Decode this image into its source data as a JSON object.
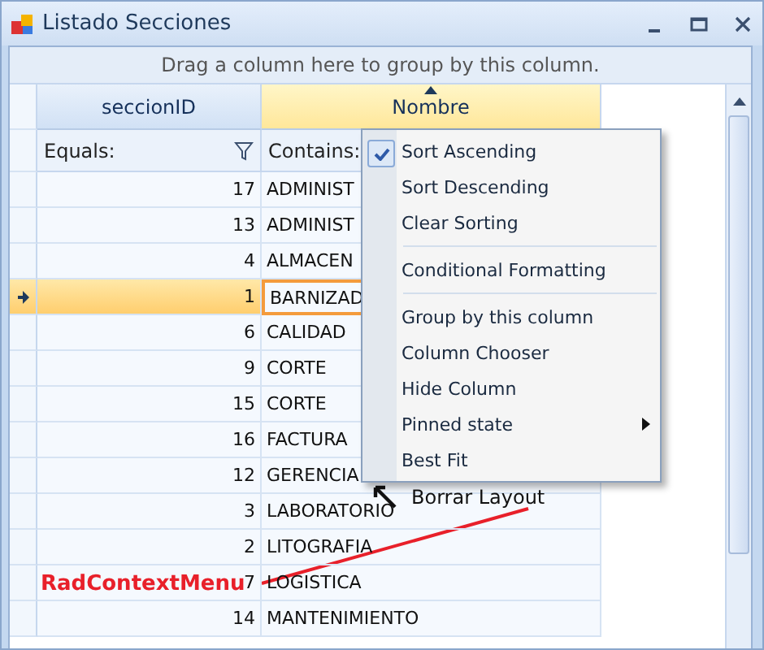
{
  "window": {
    "title": "Listado Secciones"
  },
  "group_panel": {
    "hint": "Drag a column here to group by this column."
  },
  "columns": [
    {
      "label": "seccionID",
      "sorted": false
    },
    {
      "label": "Nombre",
      "sorted": true
    }
  ],
  "filters": [
    {
      "label": "Equals:"
    },
    {
      "label": "Contains:"
    }
  ],
  "rows": [
    {
      "id": "17",
      "name": "ADMINIST",
      "selected": false
    },
    {
      "id": "13",
      "name": "ADMINIST",
      "selected": false
    },
    {
      "id": "4",
      "name": "ALMACEN",
      "selected": false
    },
    {
      "id": "1",
      "name": "BARNIZAD",
      "selected": true
    },
    {
      "id": "6",
      "name": "CALIDAD",
      "selected": false
    },
    {
      "id": "9",
      "name": "CORTE",
      "selected": false
    },
    {
      "id": "15",
      "name": "CORTE",
      "selected": false
    },
    {
      "id": "16",
      "name": "FACTURA",
      "selected": false
    },
    {
      "id": "12",
      "name": "GERENCIA",
      "selected": false
    },
    {
      "id": "3",
      "name": "LABORATORIO",
      "selected": false
    },
    {
      "id": "2",
      "name": "LITOGRAFIA",
      "selected": false
    },
    {
      "id": "7",
      "name": "LOGISTICA",
      "selected": false
    },
    {
      "id": "14",
      "name": "MANTENIMIENTO",
      "selected": false
    }
  ],
  "context_menu": {
    "items": [
      {
        "kind": "item",
        "label": "Sort Ascending",
        "checked": true
      },
      {
        "kind": "item",
        "label": "Sort Descending",
        "checked": false
      },
      {
        "kind": "item",
        "label": "Clear Sorting",
        "checked": false
      },
      {
        "kind": "separator"
      },
      {
        "kind": "item",
        "label": "Conditional Formatting",
        "checked": false
      },
      {
        "kind": "separator"
      },
      {
        "kind": "item",
        "label": "Group by this column",
        "checked": false
      },
      {
        "kind": "item",
        "label": "Column Chooser",
        "checked": false
      },
      {
        "kind": "item",
        "label": "Hide Column",
        "checked": false
      },
      {
        "kind": "submenu",
        "label": "Pinned state",
        "checked": false
      },
      {
        "kind": "item",
        "label": "Best Fit",
        "checked": false
      }
    ]
  },
  "underlying_menu_item": {
    "label": "Borrar Layout"
  },
  "annotation": {
    "label": "RadContextMenu"
  }
}
